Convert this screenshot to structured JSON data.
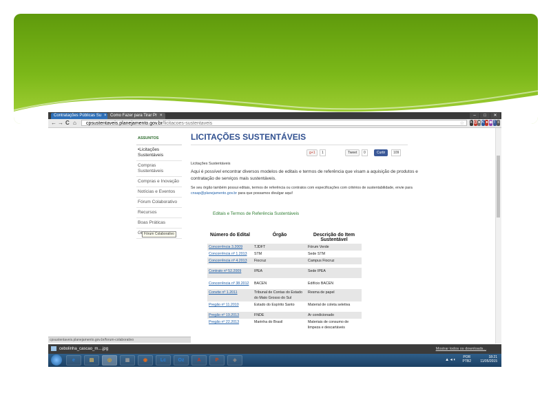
{
  "browser": {
    "tabs": [
      {
        "label": "Contratações Públicas Su"
      },
      {
        "label": "Como Fazer para Tirar Pr"
      }
    ],
    "tab_close": "×",
    "window_controls": [
      "–",
      "□",
      "✕"
    ],
    "nav": {
      "back": "←",
      "forward": "→",
      "reload": "C",
      "home": "⌂"
    },
    "url_domain": "cpsustentaveis.planejamento.gov.br",
    "url_path": "/licitacoes-sustentaveis",
    "bookmark_star": "☆",
    "extensions": [
      {
        "label": "k",
        "color": "#3a3a3a"
      },
      {
        "label": "@",
        "color": "#c0392b"
      },
      {
        "label": "●",
        "color": "#777777"
      },
      {
        "label": "K",
        "color": "#2c5aa0"
      },
      {
        "label": "●",
        "color": "#c0392b"
      },
      {
        "label": "◉",
        "color": "#8e44ad"
      },
      {
        "label": "f",
        "color": "#3b5998"
      },
      {
        "label": "≡",
        "color": "#555555"
      }
    ],
    "status_url": "cpsustentaveis.planejamento.gov.br/forum-colaborativo"
  },
  "sidebar": {
    "heading": "ASSUNTOS",
    "items": [
      {
        "label": "•Licitações Sustentáveis"
      },
      {
        "label": "Compras Sustentáveis"
      },
      {
        "label": "Compras e Inovação"
      },
      {
        "label": "Notícias e Eventos"
      },
      {
        "label": "Fórum Colaborativo"
      },
      {
        "label": "Recursos"
      },
      {
        "label": "Boas Práticas"
      },
      {
        "label": "Glossário"
      }
    ],
    "tooltip": "Fórum Colaborativo"
  },
  "main": {
    "title": "LICITAÇÕES SUSTENTÁVEIS",
    "social": {
      "gplus_label": "g+1",
      "gplus_count": "1",
      "tweet_label": "Tweet",
      "tweet_count": "0",
      "fb_label": "Curtir",
      "fb_count": "109"
    },
    "breadcrumb": "Licitações Sustentáveis",
    "intro": "Aqui é possível encontrar diversos modelos de editais e termos de referência que visam a aquisição de produtos e contratação de serviços mais sustentáveis.",
    "note_prefix": "Se seu órgão também possui editais, termos de referência ou contratos com especificações com critérios de sustentabilidade, envie para",
    "note_email": "cnsap@planejamento.gov.br",
    "note_suffix": "para que possamos divulgar aqui!",
    "link": "Editais e Termos de Referência Sustentáveis"
  },
  "table": {
    "headers": [
      "Número do Edital",
      "Órgão",
      "Descrição do Item Sustentável"
    ],
    "rows": [
      {
        "num": "Concorrência 3.2009",
        "org": "TJDFT",
        "desc": "Fórum Verde"
      },
      {
        "num": "Concorrência nº 1.2013",
        "org": "STM",
        "desc": "Sede STM"
      },
      {
        "num": "Concorrência nº 4.2013",
        "org": "Fiocruz",
        "desc": "Campus Fiocruz"
      },
      {
        "num": "Contrato nº 52.2009",
        "org": "IPEA",
        "desc": "Sede IPEA"
      },
      {
        "num": "Concorrência nº 38.2012",
        "org": "BACEN",
        "desc": "Edifício BACEN"
      },
      {
        "num": "Convite nº 1.2011",
        "org": "Tribunal de Contas do Estado do Mato Grosso do Sul",
        "desc": "Resma de papel"
      },
      {
        "num": "Pregão nº 11.2010",
        "org": "Estado do Espírito Santo",
        "desc": "Material de coleta seletiva"
      },
      {
        "num": "Pregão nº 19.2013",
        "org": "FNDE",
        "desc": "Ar condicionado"
      },
      {
        "num": "Pregão nº 22.2013",
        "org": "Marinha do Brasil",
        "desc": "Materiais de consumo de limpeza e descartáveis"
      }
    ]
  },
  "download_bar": {
    "file": "cebolinha_cascao_m....jpg",
    "show_all": "Mostrar todos os downloads..."
  },
  "taskbar": {
    "apps": [
      "e",
      "▤",
      "◎",
      "▦",
      "◉",
      "Lc",
      "Oz",
      "A",
      "P",
      "◈"
    ],
    "app_colors": [
      "#2a7fd4",
      "#d8b460",
      "#e0a020",
      "#999999",
      "#e56a1a",
      "#2a7fd4",
      "#2a7fd4",
      "#c0392b",
      "#d04a1a",
      "#888888"
    ],
    "lang": "POR",
    "lang_sub": "PTB2",
    "time": "18:21",
    "date": "11/05/2015"
  }
}
